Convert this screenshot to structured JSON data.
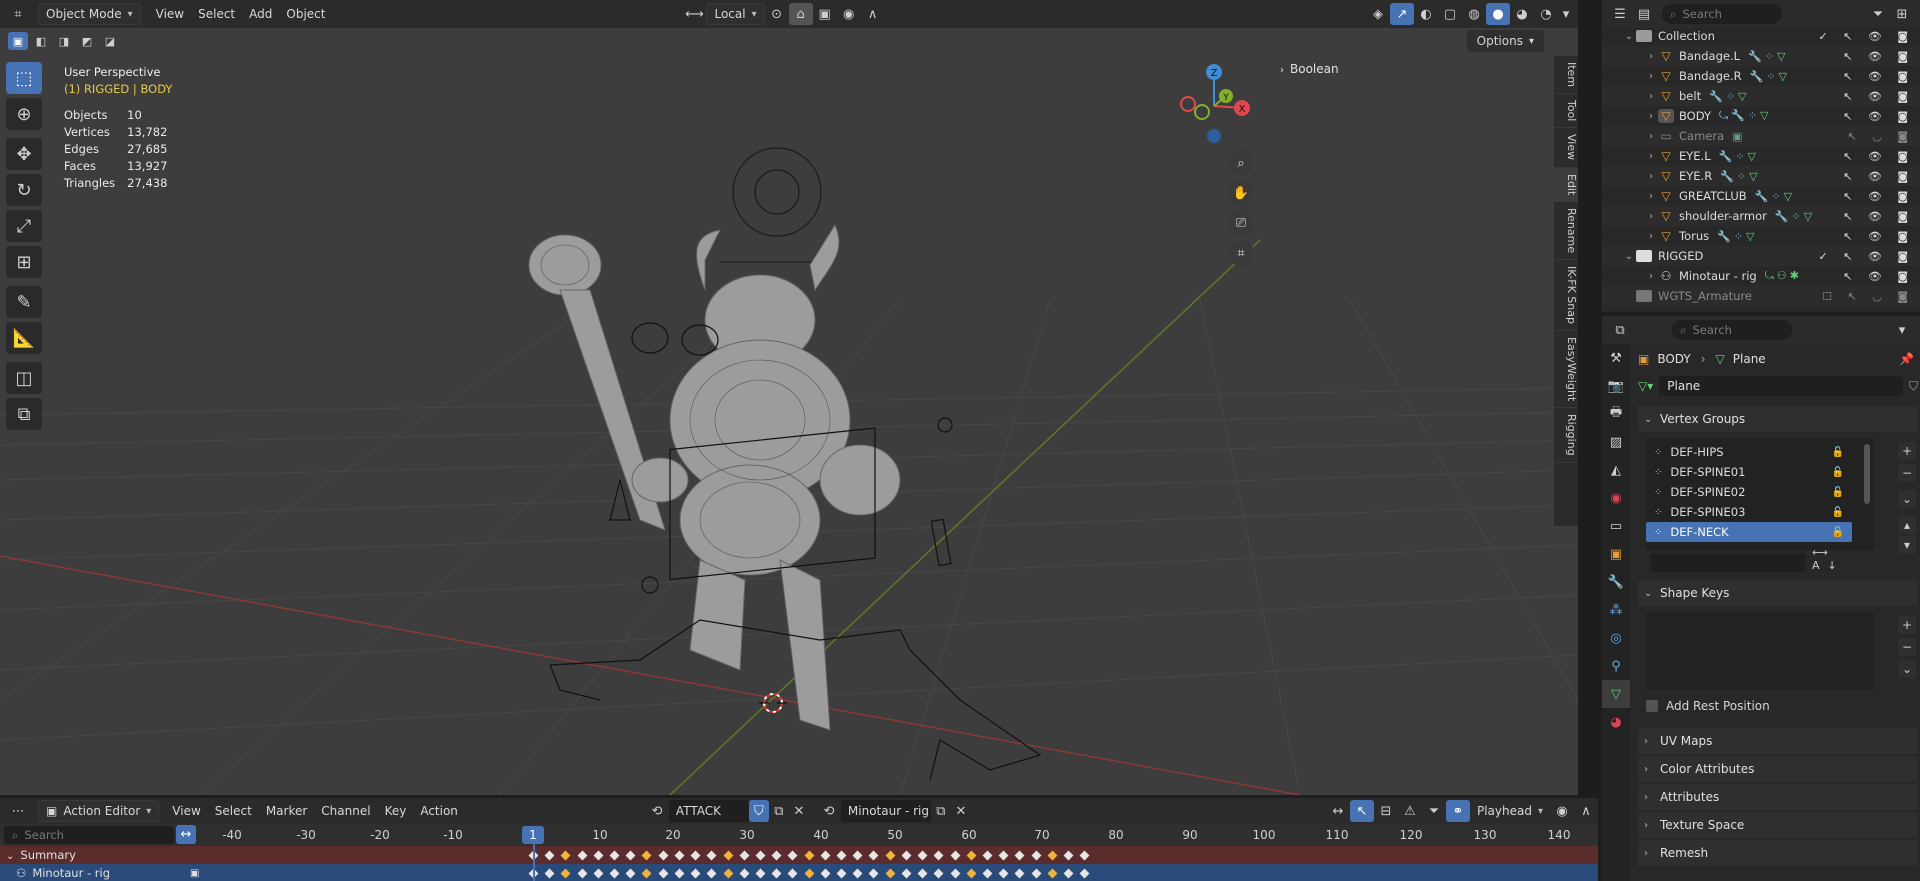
{
  "viewport": {
    "mode": "Object Mode",
    "menu": [
      "View",
      "Select",
      "Add",
      "Object"
    ],
    "transform_orientation": "Local",
    "options": "Options",
    "perspective": "User Perspective",
    "context": "(1) RIGGED | BODY",
    "stats": [
      {
        "label": "Objects",
        "value": "10"
      },
      {
        "label": "Vertices",
        "value": "13,782"
      },
      {
        "label": "Edges",
        "value": "27,685"
      },
      {
        "label": "Faces",
        "value": "13,927"
      },
      {
        "label": "Triangles",
        "value": "27,438"
      }
    ],
    "boolean": "Boolean",
    "side_tabs": [
      "Item",
      "Tool",
      "View",
      "Edit",
      "Rename",
      "IK-FK Snap",
      "EasyWeight",
      "Rigging"
    ],
    "gizmo": {
      "x": "X",
      "y": "Y",
      "z": "Z"
    },
    "colors": {
      "x_axis": "#e0474e",
      "y_axis": "#84b12b",
      "z_axis": "#3e8ed8",
      "accent": "#4772b3"
    }
  },
  "outliner": {
    "search_placeholder": "Search",
    "rows": [
      {
        "name": "Collection",
        "kind": "collection"
      },
      {
        "name": "Bandage.L",
        "kind": "mesh"
      },
      {
        "name": "Bandage.R",
        "kind": "mesh"
      },
      {
        "name": "belt",
        "kind": "mesh"
      },
      {
        "name": "BODY",
        "kind": "mesh"
      },
      {
        "name": "Camera",
        "kind": "camera"
      },
      {
        "name": "EYE.L",
        "kind": "mesh"
      },
      {
        "name": "EYE.R",
        "kind": "mesh"
      },
      {
        "name": "GREATCLUB",
        "kind": "mesh"
      },
      {
        "name": "shoulder-armor",
        "kind": "mesh"
      },
      {
        "name": "Torus",
        "kind": "mesh"
      },
      {
        "name": "RIGGED",
        "kind": "collection"
      },
      {
        "name": "Minotaur - rig",
        "kind": "armature"
      },
      {
        "name": "WGTS_Armature",
        "kind": "collection"
      }
    ]
  },
  "properties": {
    "search_placeholder": "Search",
    "breadcrumb": {
      "object": "BODY",
      "data": "Plane"
    },
    "mesh_name": "Plane",
    "vertex_groups_title": "Vertex Groups",
    "vertex_groups": [
      "DEF-HIPS",
      "DEF-SPINE01",
      "DEF-SPINE02",
      "DEF-SPINE03",
      "DEF-NECK"
    ],
    "selected_group": "DEF-NECK",
    "shape_keys_title": "Shape Keys",
    "add_rest_position": "Add Rest Position",
    "panels": [
      "UV Maps",
      "Color Attributes",
      "Attributes",
      "Texture Space",
      "Remesh"
    ]
  },
  "action_editor": {
    "editor": "Action Editor",
    "menu": [
      "View",
      "Select",
      "Marker",
      "Channel",
      "Key",
      "Action"
    ],
    "action": "ATTACK",
    "object": "Minotaur - rig",
    "playhead_mode": "Playhead",
    "search_placeholder": "Search",
    "current_frame": "1",
    "ticks": [
      "-40",
      "-30",
      "-20",
      "-10",
      "10",
      "20",
      "30",
      "40",
      "50",
      "60",
      "70",
      "80",
      "90",
      "100",
      "110",
      "120",
      "130",
      "140"
    ],
    "channels": [
      "Summary",
      "Minotaur - rig"
    ]
  }
}
